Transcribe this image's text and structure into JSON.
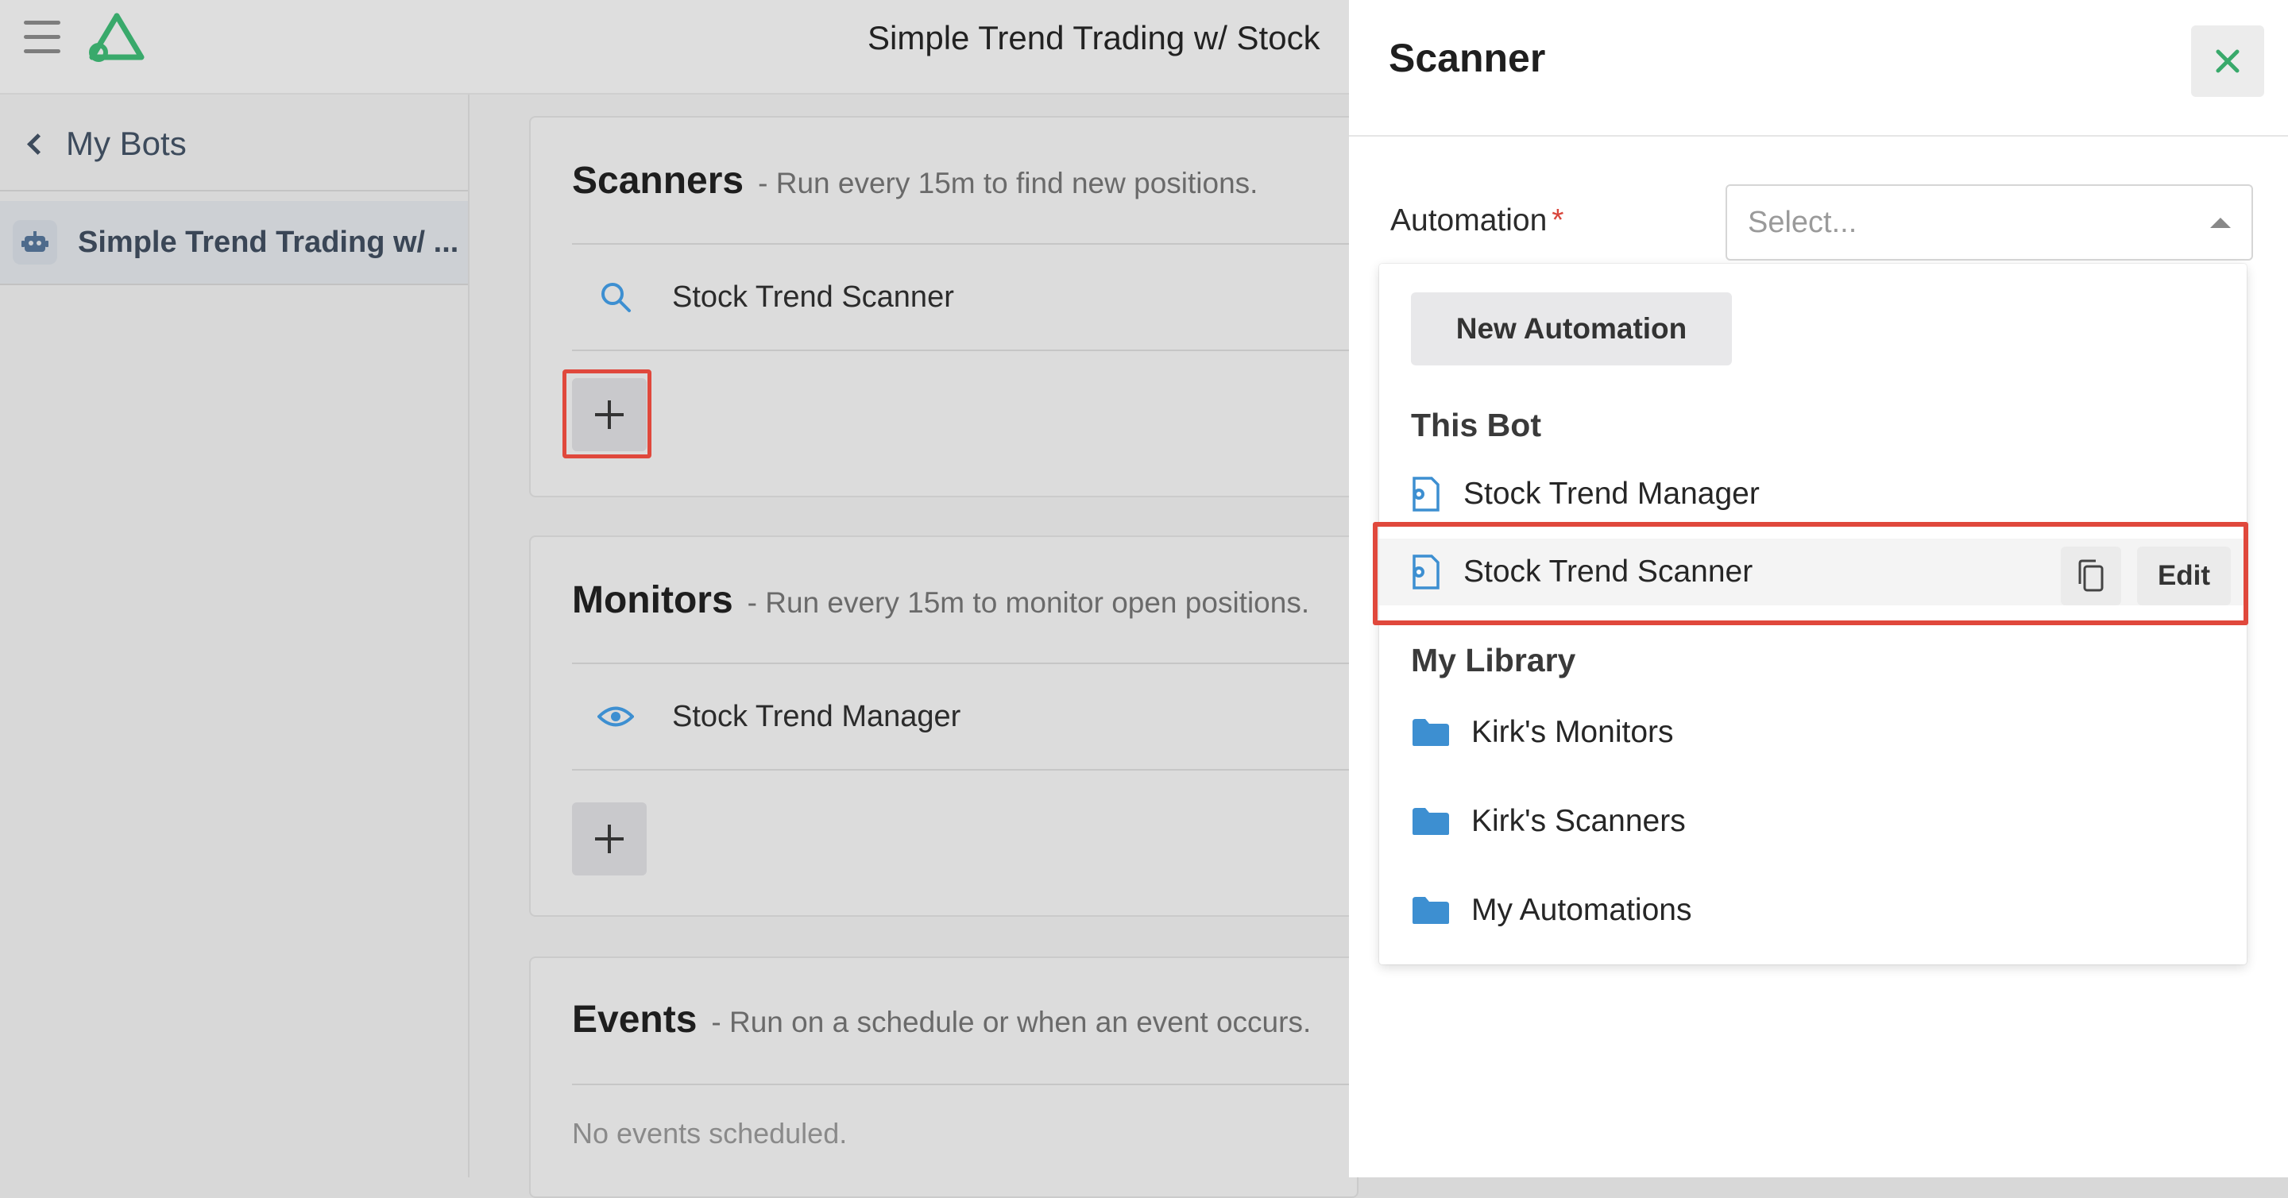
{
  "app": {
    "title": "Simple Trend Trading w/ Stock"
  },
  "sidebar": {
    "back_label": "My Bots",
    "bot_label": "Simple Trend Trading w/ ..."
  },
  "main": {
    "scanners": {
      "title": "Scanners",
      "subtitle": "- Run every 15m to find new positions.",
      "items": [
        {
          "label": "Stock Trend Scanner",
          "icon": "search-icon"
        }
      ]
    },
    "monitors": {
      "title": "Monitors",
      "subtitle": "- Run every 15m to monitor open positions.",
      "items": [
        {
          "label": "Stock Trend Manager",
          "icon": "eye-icon"
        }
      ]
    },
    "events": {
      "title": "Events",
      "subtitle": "- Run on a schedule or when an event occurs.",
      "empty_text": "No events scheduled."
    }
  },
  "panel": {
    "title": "Scanner",
    "automation_label": "Automation",
    "required_mark": "*",
    "select_placeholder": "Select...",
    "dropdown": {
      "new_button": "New Automation",
      "this_bot_heading": "This Bot",
      "this_bot_items": [
        {
          "label": "Stock Trend Manager"
        },
        {
          "label": "Stock Trend Scanner",
          "edit_label": "Edit"
        }
      ],
      "library_heading": "My Library",
      "library_folders": [
        {
          "label": "Kirk's Monitors"
        },
        {
          "label": "Kirk's Scanners"
        },
        {
          "label": "My Automations"
        }
      ]
    }
  },
  "colors": {
    "accent_green": "#39a96b",
    "icon_blue": "#3d8fd1",
    "highlight_red": "#e0483c"
  }
}
